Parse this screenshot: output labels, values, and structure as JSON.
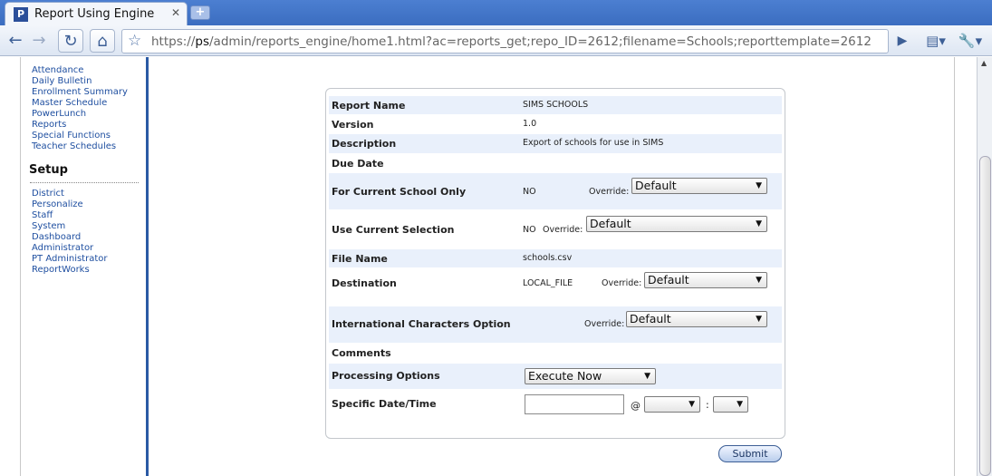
{
  "browser": {
    "tab_title": "Report Using Engine",
    "url_host": "ps",
    "url_prefix": "https://",
    "url_path": "/admin/reports_engine/home1.html?ac=reports_get;repo_ID=2612;filename=Schools;reporttemplate=2612"
  },
  "sidebar": {
    "links_top": [
      "Attendance",
      "Daily Bulletin",
      "Enrollment Summary",
      "Master Schedule",
      "PowerLunch",
      "Reports",
      "Special Functions",
      "Teacher Schedules"
    ],
    "setup_heading": "Setup",
    "links_setup": [
      "District",
      "Personalize",
      "Staff",
      "System",
      "Dashboard",
      "Administrator",
      "PT Administrator",
      "ReportWorks"
    ]
  },
  "report": {
    "report_name_label": "Report Name",
    "report_name": "SIMS SCHOOLS",
    "version_label": "Version",
    "version": "1.0",
    "description_label": "Description",
    "description": "Export of schools for use in SIMS",
    "due_date_label": "Due Date",
    "current_school_label": "For Current School Only",
    "current_school_value": "NO",
    "current_selection_label": "Use Current Selection",
    "current_selection_value": "NO",
    "file_name_label": "File Name",
    "file_name": "schools.csv",
    "destination_label": "Destination",
    "destination_value": "LOCAL_FILE",
    "intl_label": "International Characters Option",
    "comments_label": "Comments",
    "processing_label": "Processing Options",
    "processing_value": "Execute Now",
    "datetime_label": "Specific Date/Time",
    "override_label": "Override:",
    "default_option": "Default",
    "at_sign": "@",
    "colon": ":"
  },
  "submit_label": "Submit"
}
